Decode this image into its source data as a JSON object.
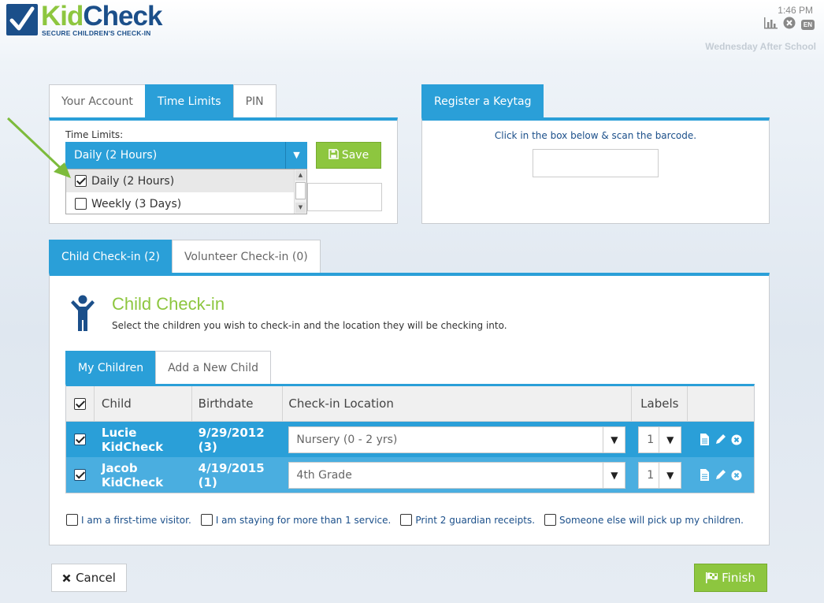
{
  "header": {
    "brand": "KidCheck",
    "brand_part1": "Kid",
    "brand_part2": "Check",
    "tagline": "SECURE CHILDREN'S CHECK-IN",
    "time": "1:46 PM",
    "language": "EN",
    "event_name": "Wednesday After School",
    "icons": [
      "chart-icon",
      "close-circle-icon",
      "language-badge"
    ]
  },
  "account_panel": {
    "tabs": [
      "Your Account",
      "Time Limits",
      "PIN"
    ],
    "active_tab": "Time Limits",
    "time_limits_label": "Time Limits:",
    "selected_value": "Daily (2 Hours)",
    "save_label": "Save",
    "options": [
      {
        "label": "Daily (2 Hours)",
        "checked": true
      },
      {
        "label": "Weekly (3 Days)",
        "checked": false
      }
    ]
  },
  "keytag_panel": {
    "tab": "Register a Keytag",
    "instruction": "Click in the box below & scan the barcode.",
    "input_value": ""
  },
  "checkin_panel": {
    "tabs": [
      "Child Check-in (2)",
      "Volunteer Check-in (0)"
    ],
    "active_tab": "Child Check-in (2)",
    "title": "Child Check-in",
    "subtitle": "Select the children you wish to check-in and the location they will be checking into.",
    "subtabs": [
      "My Children",
      "Add a New Child"
    ],
    "active_subtab": "My Children",
    "columns": [
      "Child",
      "Birthdate",
      "Check-in Location",
      "Labels"
    ],
    "rows": [
      {
        "checked": true,
        "child": "Lucie KidCheck",
        "birthdate": "9/29/2012 (3)",
        "location": "Nursery (0 - 2 yrs)",
        "labels": "1"
      },
      {
        "checked": true,
        "child": "Jacob KidCheck",
        "birthdate": "4/19/2015 (1)",
        "location": "4th Grade",
        "labels": "1"
      }
    ],
    "options": [
      "I am a first-time visitor.",
      "I am staying for more than 1 service.",
      "Print 2 guardian receipts.",
      "Someone else will pick up my children."
    ]
  },
  "footer": {
    "cancel_label": "Cancel",
    "finish_label": "Finish"
  },
  "colors": {
    "primary_blue": "#2a9fd8",
    "brand_green": "#8dc63f",
    "brand_navy": "#1b4f8a",
    "annotation_arrow": "#7dbb3c"
  }
}
